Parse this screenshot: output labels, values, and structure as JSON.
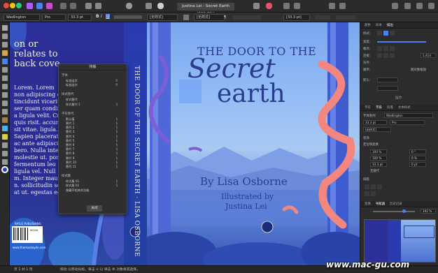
{
  "topbar": {
    "doc_title": "Justina Lei - Secret Earth (192.6%)"
  },
  "context": {
    "font": "Wadlington",
    "style": "Pro",
    "size": "33.3 pt",
    "bold": "B",
    "italic": "I",
    "underline": "U",
    "none1": "[无样式]",
    "none2": "[无样式]",
    "size2": "[33.3 pt]"
  },
  "back_cover": {
    "line1": "on or",
    "line2": "relates to",
    "line3": "back cove",
    "lorem1": "Lorem.  Lorem",
    "lorem2": "non adipiscing e",
    "lorem3": "tincidunt vicariu",
    "lorem4": "ser quam condim",
    "lorem5": "a ligula velit. Cr",
    "lorem6": "quis risit. accumsan",
    "lorem7": "sit vitae. ligula.",
    "lorem8": "Sapien placerat s",
    "lorem9": "ac ante adipiscing",
    "lorem10": "bero.  Nulla inte",
    "lorem11": "molestie ut. porta",
    "lorem12": "fermentum leo ",
    "lorem13": "ligula vel. Null",
    "lorem14": "m. Integer mau",
    "lorem15": "n. sollicitudin se",
    "lorem16": "at ut. egestas eg",
    "publisher": "RAYLE PUBLISHING",
    "barcode_num": "90100",
    "url": "www.thomaskaylin.com"
  },
  "spine": {
    "text": "THE DOOR OF THE SECRET EARTH · LISA OSBORNE"
  },
  "front": {
    "title_line1": "THE DOOR TO THE",
    "title_line2": "Secret",
    "title_line3": "earth",
    "author": "By Lisa Osborne",
    "illus1": "Illustrated by",
    "illus2": "Justina Lei"
  },
  "glyph_panel": {
    "title": "排版",
    "sections": [
      {
        "header": "字体",
        "rows": [
          {
            "label": "标准连字",
            "sym": "ﬁ"
          },
          {
            "label": "标准连字",
            "sym": "ﬂ"
          }
        ]
      },
      {
        "header": "样式替代",
        "rows": [
          {
            "label": "样式替代",
            "sym": ""
          },
          {
            "label": "样式替代 1",
            "sym": "§"
          }
        ]
      },
      {
        "header": "字符替代",
        "rows": [
          {
            "label": "默认值",
            "sym": "§"
          },
          {
            "label": "替代 1",
            "sym": "§"
          },
          {
            "label": "替代 2",
            "sym": "§"
          },
          {
            "label": "替代 3",
            "sym": "§"
          },
          {
            "label": "替代 4",
            "sym": "§"
          },
          {
            "label": "替代 5",
            "sym": "§"
          },
          {
            "label": "替代 6",
            "sym": "§"
          },
          {
            "label": "替代 7",
            "sym": "§"
          },
          {
            "label": "替代 8",
            "sym": "§"
          },
          {
            "label": "替代 9",
            "sym": "§"
          },
          {
            "label": "替代 10",
            "sym": "§"
          },
          {
            "label": "替代 11",
            "sym": "§"
          }
        ]
      },
      {
        "header": "样式集",
        "rows": [
          {
            "label": "样式集 01",
            "sym": "§"
          },
          {
            "label": "样式集 02",
            "sym": "§"
          },
          {
            "label": "隐藏不相关的功能",
            "sym": ""
          }
        ]
      }
    ],
    "close": "关闭"
  },
  "right_panel": {
    "tabs1": [
      "颜色",
      "样本",
      "描边"
    ],
    "stroke_label": "样式:",
    "width_label": "宽度:",
    "cap_label": "端点:",
    "join_label": "连接:",
    "align_label": "对齐:",
    "order_label": "顺序:",
    "scale_label": "随对象缩放",
    "arrows_label": "箭头:",
    "miter": "1.414",
    "pressure": "压力",
    "tabs2": [
      "字符",
      "字段",
      "段落",
      "文本样式"
    ],
    "font_family_label": "字体系列",
    "font_name": "Wadlington",
    "font_size": "33.3 pt",
    "font_style": "Pro",
    "nostyle": "[无样式]",
    "decor_label": "装饰",
    "position_label": "定位和变换",
    "pct1": "100 %",
    "pct2": "100 %",
    "deg": "0 °",
    "zero": "0 %",
    "pt": "33.3 pt",
    "pt2": "0 pt",
    "baseline": "无替代",
    "typography_label": "排版",
    "nav_tabs": [
      "变换",
      "导航器",
      "历史记录"
    ],
    "zoom": "192 %"
  },
  "status": {
    "page": "页 1 共 1 页",
    "info": "拖动 以移动光标。单击 + 以 单击 ⌘ 对象将其选择。"
  },
  "watermark": "www.mac-gu.com",
  "colors": {
    "accent": "#4e7ff0",
    "cover_blue": "#2d2f9a",
    "sky": "#93bdf5",
    "snake": "#f3877f"
  }
}
